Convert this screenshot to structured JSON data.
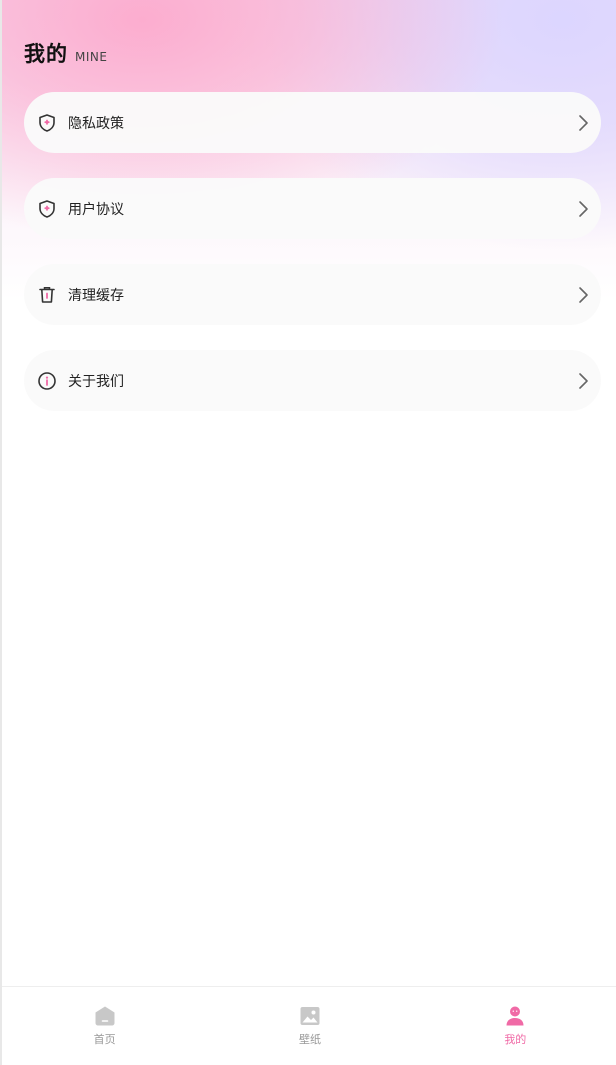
{
  "header": {
    "title": "我的",
    "subtitle": "MINE"
  },
  "menu": {
    "items": [
      {
        "label": "隐私政策",
        "icon": "shield-icon"
      },
      {
        "label": "用户协议",
        "icon": "shield-icon"
      },
      {
        "label": "清理缓存",
        "icon": "trash-icon"
      },
      {
        "label": "关于我们",
        "icon": "info-icon"
      }
    ]
  },
  "tabbar": {
    "tabs": [
      {
        "label": "首页",
        "icon": "home-icon",
        "active": false
      },
      {
        "label": "壁纸",
        "icon": "image-icon",
        "active": false
      },
      {
        "label": "我的",
        "icon": "user-icon",
        "active": true
      }
    ]
  },
  "colors": {
    "accent": "#f06aa6",
    "inactive": "#999999",
    "icon_dark": "#333333"
  }
}
